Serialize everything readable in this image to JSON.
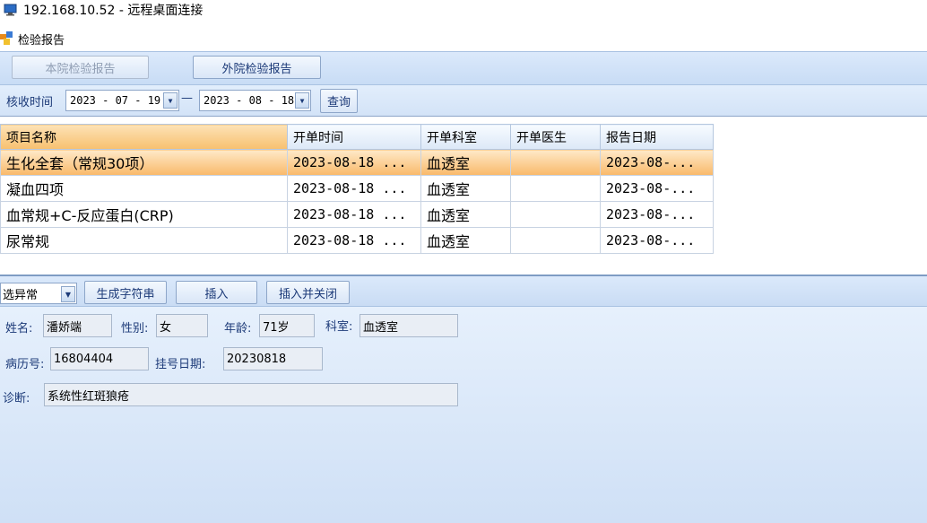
{
  "rdp": {
    "title": "192.168.10.52 - 远程桌面连接",
    "icon": "remote-desktop-icon"
  },
  "window": {
    "title": "检验报告",
    "icon": "report-app-icon"
  },
  "toolbar": {
    "internal_label": "本院检验报告",
    "external_label": "外院检验报告"
  },
  "filter": {
    "label": "核收时间",
    "start_date": "2023 - 07 - 19",
    "separator": "—",
    "end_date": "2023 - 08 - 18",
    "query_label": "查询"
  },
  "grid": {
    "columns": [
      "项目名称",
      "开单时间",
      "开单科室",
      "开单医生",
      "报告日期"
    ],
    "rows": [
      [
        "生化全套（常规30项）",
        "2023-08-18 ...",
        "血透室",
        "",
        "2023-08-..."
      ],
      [
        "凝血四项",
        "2023-08-18 ...",
        "血透室",
        "",
        "2023-08-..."
      ],
      [
        "血常规+C-反应蛋白(CRP)",
        "2023-08-18 ...",
        "血透室",
        "",
        "2023-08-..."
      ],
      [
        "尿常规",
        "2023-08-18 ...",
        "血透室",
        "",
        "2023-08-..."
      ]
    ],
    "selected_row": 0
  },
  "actions": {
    "select_value": "选异常",
    "generate_label": "生成字符串",
    "insert_label": "插入",
    "insert_close_label": "插入并关闭"
  },
  "patient": {
    "name_label": "姓名:",
    "name": "潘娇端",
    "gender_label": "性别:",
    "gender": "女",
    "age_label": "年龄:",
    "age": "71岁",
    "dept_label": "科室:",
    "dept": "血透室",
    "record_label": "病历号:",
    "record": "16804404",
    "reg_label": "挂号日期:",
    "reg_date": "20230818",
    "diag_label": "诊断:",
    "diagnosis": "系统性红斑狼疮"
  },
  "colors": {
    "accent": "#c8dcf5",
    "selection": "#f9b96a",
    "text": "#1c3a78"
  }
}
